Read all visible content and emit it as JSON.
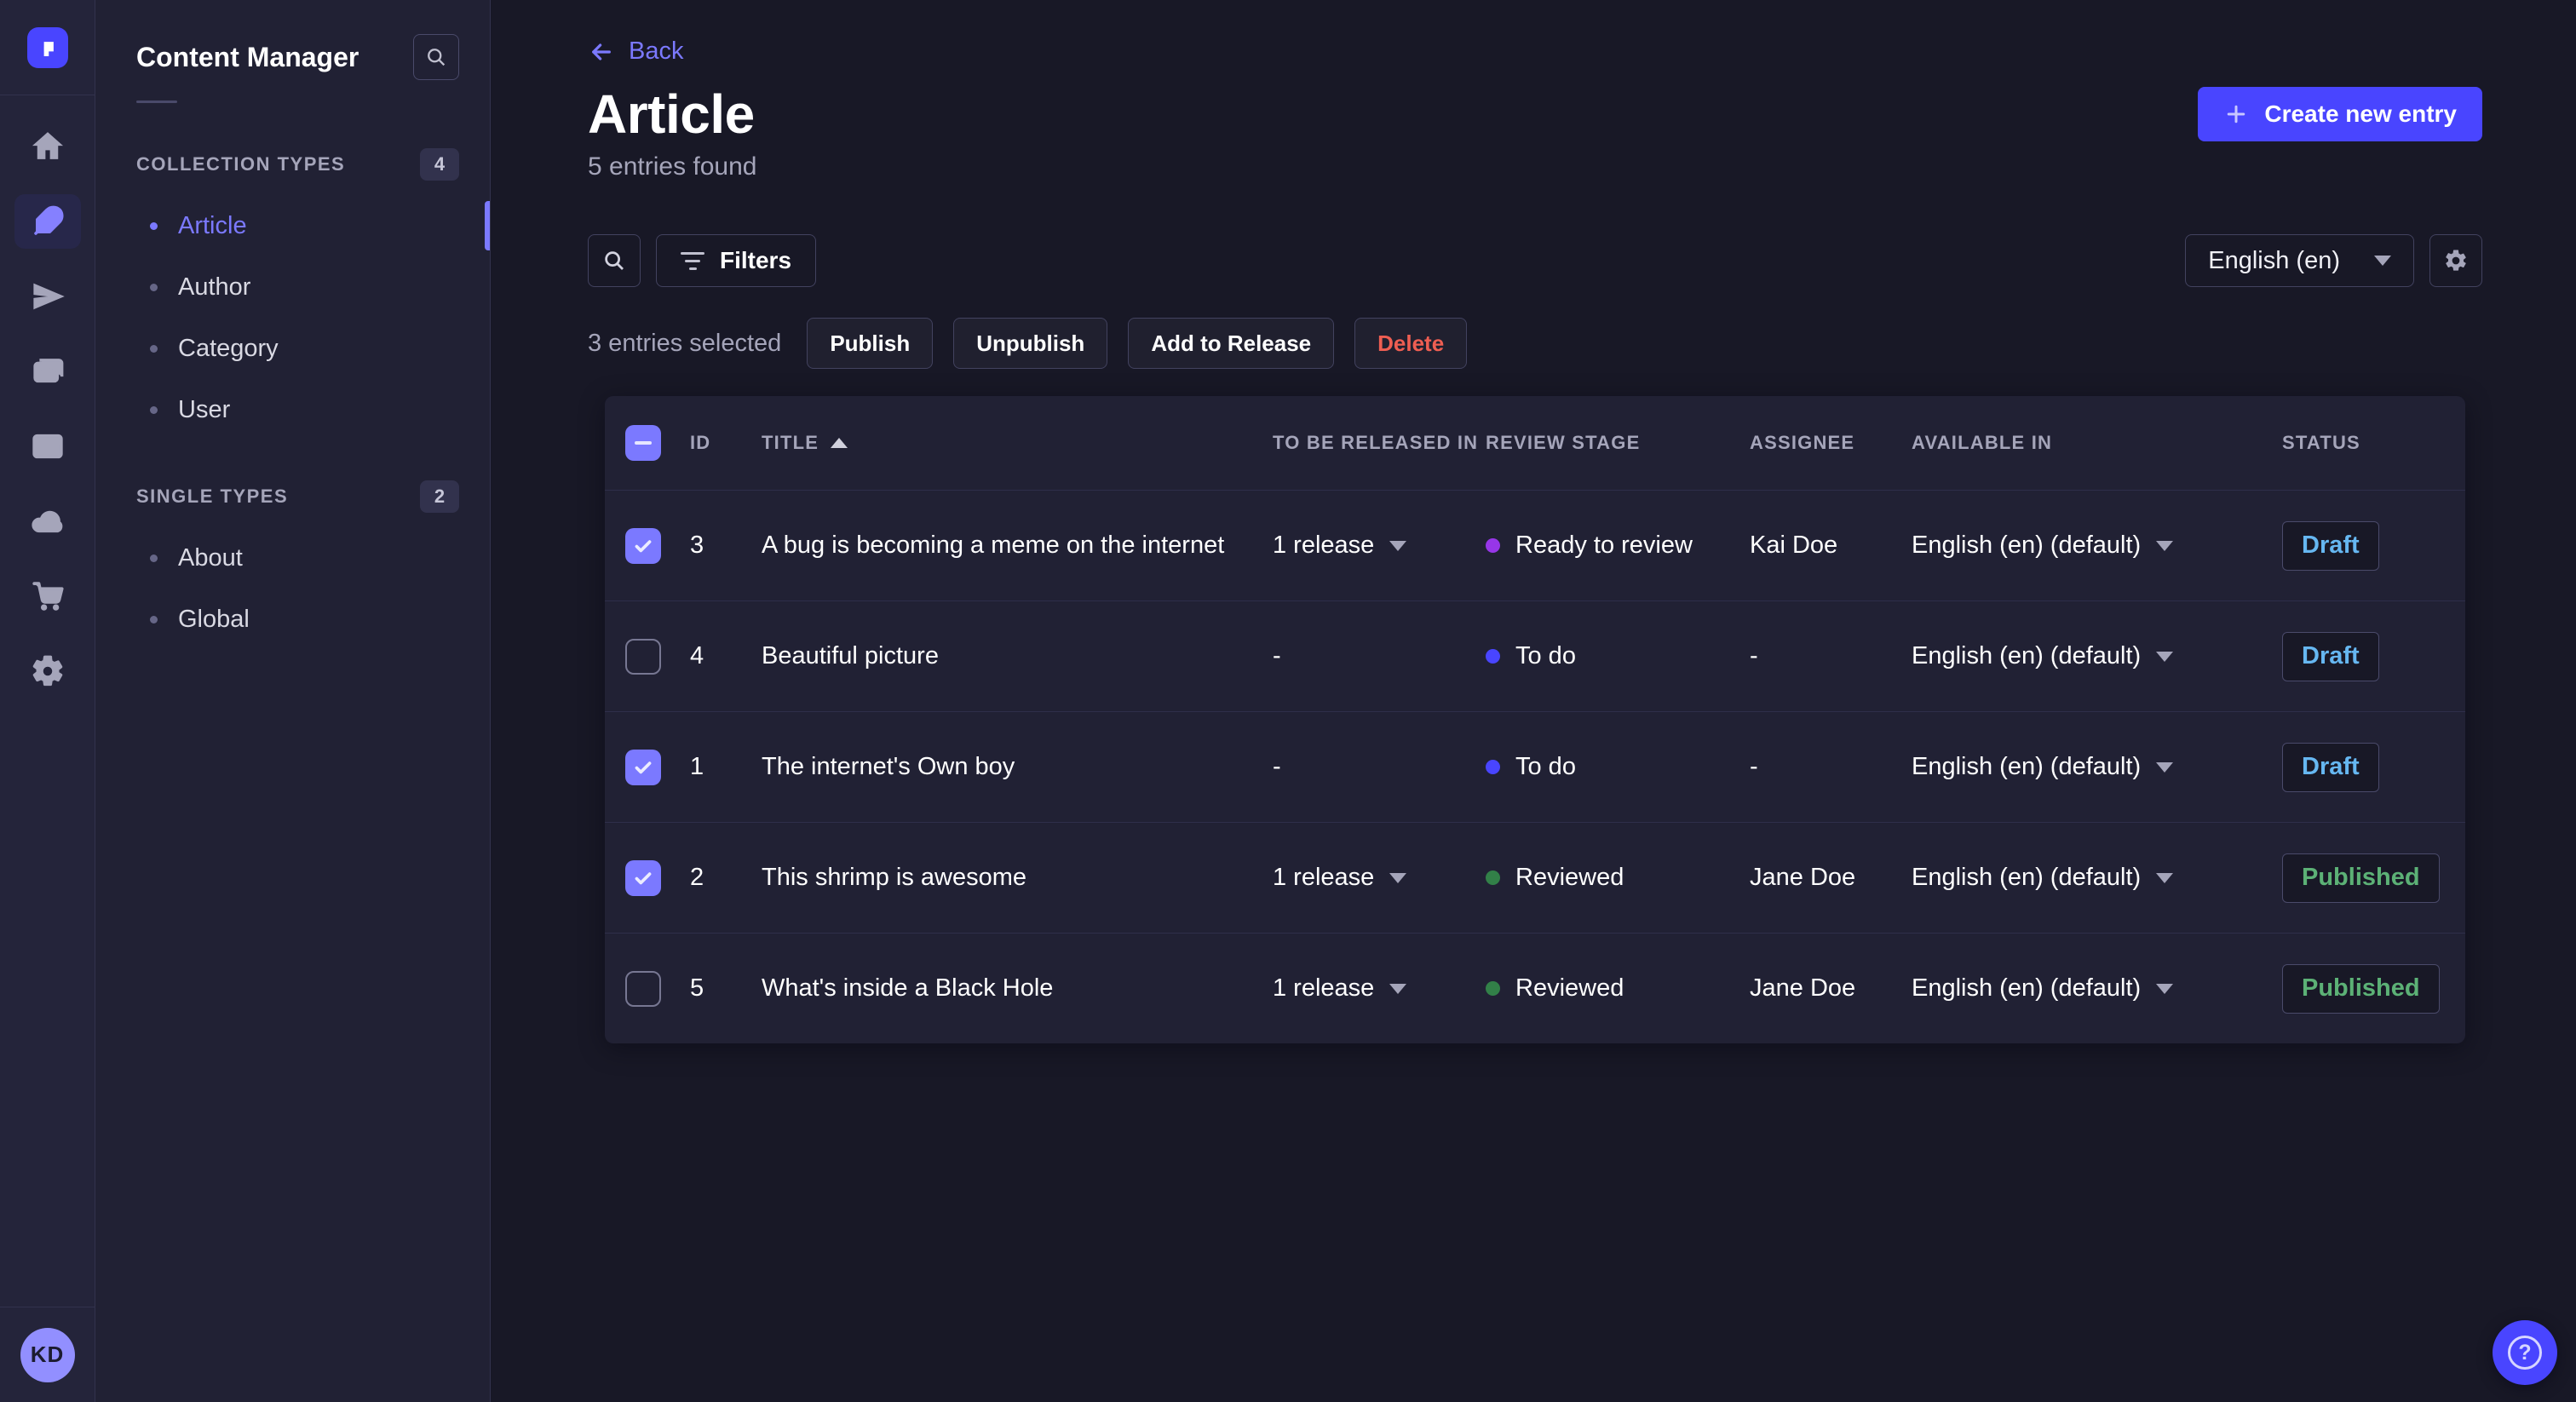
{
  "colors": {
    "accent": "#4945ff",
    "accent_light": "#7b79ff",
    "danger_text": "#ee5e52",
    "draft_text": "#66b7f1",
    "published_text": "#5cb176",
    "stage_todo": "#4945ff",
    "stage_ready": "#9736e8",
    "stage_reviewed": "#328048"
  },
  "rail": {
    "items": [
      {
        "icon": "home-icon",
        "active": false
      },
      {
        "icon": "feather-icon",
        "active": true
      },
      {
        "icon": "paper-plane-icon",
        "active": false
      },
      {
        "icon": "media-library-icon",
        "active": false
      },
      {
        "icon": "layout-icon",
        "active": false
      },
      {
        "icon": "cloud-icon",
        "active": false
      },
      {
        "icon": "cart-icon",
        "active": false
      },
      {
        "icon": "gear-icon",
        "active": false
      }
    ],
    "avatar_initials": "KD"
  },
  "subnav": {
    "title": "Content Manager",
    "sections": [
      {
        "label": "COLLECTION TYPES",
        "badge": "4",
        "items": [
          {
            "label": "Article",
            "active": true
          },
          {
            "label": "Author",
            "active": false
          },
          {
            "label": "Category",
            "active": false
          },
          {
            "label": "User",
            "active": false
          }
        ]
      },
      {
        "label": "SINGLE TYPES",
        "badge": "2",
        "items": [
          {
            "label": "About",
            "active": false
          },
          {
            "label": "Global",
            "active": false
          }
        ]
      }
    ]
  },
  "header": {
    "back_label": "Back",
    "title": "Article",
    "subtitle": "5 entries found",
    "create_button_label": "Create new entry"
  },
  "toolbar": {
    "filters_label": "Filters",
    "locale_value": "English (en)"
  },
  "selection": {
    "summary": "3 entries selected",
    "publish_label": "Publish",
    "unpublish_label": "Unpublish",
    "add_to_release_label": "Add to Release",
    "delete_label": "Delete"
  },
  "table": {
    "headers": {
      "id": "ID",
      "title": "TITLE",
      "released": "TO BE RELEASED IN",
      "review": "REVIEW STAGE",
      "assignee": "ASSIGNEE",
      "available": "AVAILABLE IN",
      "status": "STATUS"
    },
    "sort": {
      "column": "TITLE",
      "direction": "asc"
    },
    "header_checkbox_state": "indeterminate",
    "rows": [
      {
        "checked": true,
        "id": "3",
        "title": "A bug is becoming a meme on the internet",
        "released": "1 release",
        "released_dropdown": true,
        "review_stage": "Ready to review",
        "review_color": "#9736e8",
        "assignee": "Kai Doe",
        "available": "English (en) (default)",
        "status": "Draft",
        "status_color": "#66b7f1"
      },
      {
        "checked": false,
        "id": "4",
        "title": "Beautiful picture",
        "released": "-",
        "released_dropdown": false,
        "review_stage": "To do",
        "review_color": "#4945ff",
        "assignee": "-",
        "available": "English (en) (default)",
        "status": "Draft",
        "status_color": "#66b7f1"
      },
      {
        "checked": true,
        "id": "1",
        "title": "The internet's Own boy",
        "released": "-",
        "released_dropdown": false,
        "review_stage": "To do",
        "review_color": "#4945ff",
        "assignee": "-",
        "available": "English (en) (default)",
        "status": "Draft",
        "status_color": "#66b7f1"
      },
      {
        "checked": true,
        "id": "2",
        "title": "This shrimp is awesome",
        "released": "1 release",
        "released_dropdown": true,
        "review_stage": "Reviewed",
        "review_color": "#328048",
        "assignee": "Jane Doe",
        "available": "English (en) (default)",
        "status": "Published",
        "status_color": "#5cb176"
      },
      {
        "checked": false,
        "id": "5",
        "title": "What's inside a Black Hole",
        "released": "1 release",
        "released_dropdown": true,
        "review_stage": "Reviewed",
        "review_color": "#328048",
        "assignee": "Jane Doe",
        "available": "English (en) (default)",
        "status": "Published",
        "status_color": "#5cb176"
      }
    ]
  }
}
